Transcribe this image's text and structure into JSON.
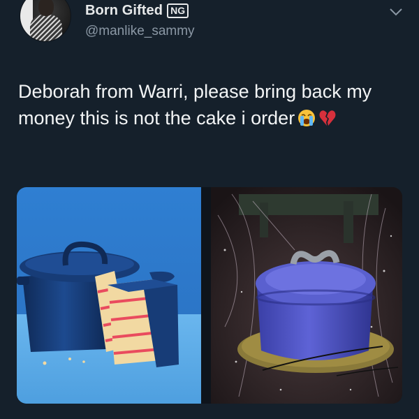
{
  "tweet": {
    "author_name": "Born Gifted",
    "country_badge": "NG",
    "handle": "@manlike_sammy",
    "text": "Deborah from Warri, please bring back my money this is not the cake i order",
    "emojis": [
      "crying-face",
      "broken-heart"
    ]
  },
  "media": {
    "count": 2,
    "items": [
      "expected-cake-photo",
      "received-cake-photo"
    ]
  },
  "colors": {
    "background": "#15202b",
    "text": "#e7e9ea",
    "secondary_text": "#8b98a5",
    "photo_left_background": "#2c73c4",
    "cake_blue": "#173c77"
  }
}
